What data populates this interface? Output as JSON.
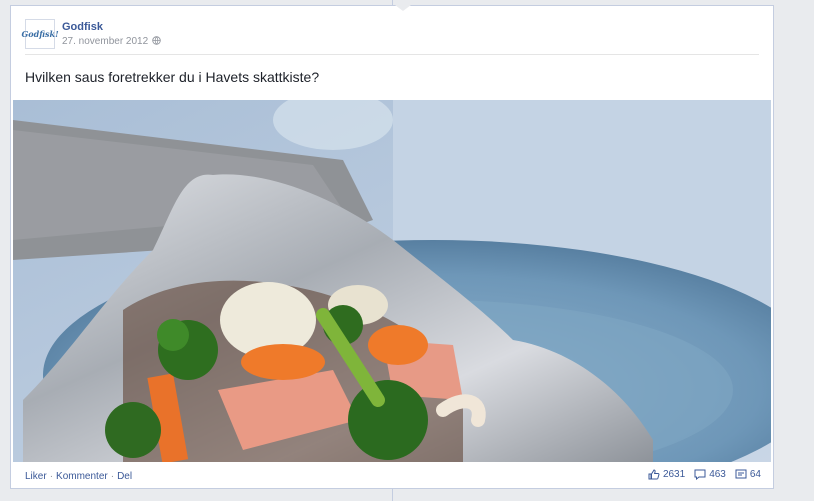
{
  "post": {
    "author": "Godfisk",
    "avatar_text": "Godfisk!",
    "date": "27. november 2012",
    "message": "Hvilken saus foretrekker du i Havets skattkiste?",
    "photo_icon": "photo-of-fish-and-vegetables-in-foil"
  },
  "actions": {
    "like": "Liker",
    "separator": "·",
    "comment": "Kommenter",
    "share": "Del"
  },
  "stats": {
    "likes": "2631",
    "comments": "463",
    "shares": "64"
  },
  "colors": {
    "link": "#3b5998",
    "background": "#e9ebee",
    "border": "#c4cde0"
  }
}
